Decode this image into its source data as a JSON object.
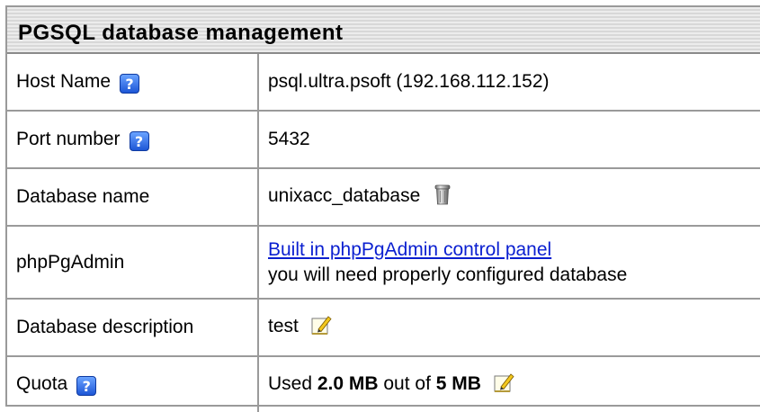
{
  "panel": {
    "title": "PGSQL database management"
  },
  "rows": {
    "host": {
      "label": "Host Name",
      "value": "psql.ultra.psoft (192.168.112.152)"
    },
    "port": {
      "label": "Port number",
      "value": "5432"
    },
    "dbname": {
      "label": "Database name",
      "value": "unixacc_database"
    },
    "phppgadmin": {
      "label": "phpPgAdmin",
      "link_text": "Built in phpPgAdmin control panel",
      "note": "you will need properly configured database"
    },
    "description": {
      "label": "Database description",
      "value": "test"
    },
    "quota": {
      "label": "Quota",
      "prefix": "Used ",
      "used": "2.0 MB",
      "middle": " out of ",
      "total": "5 MB"
    }
  },
  "icons": {
    "help": "help-icon",
    "help_glyph": "?",
    "trash": "trash-icon",
    "edit": "edit-icon"
  },
  "colors": {
    "link": "#0a1fd0",
    "help_icon": "#1d56d6",
    "border": "#9a9a9a"
  }
}
